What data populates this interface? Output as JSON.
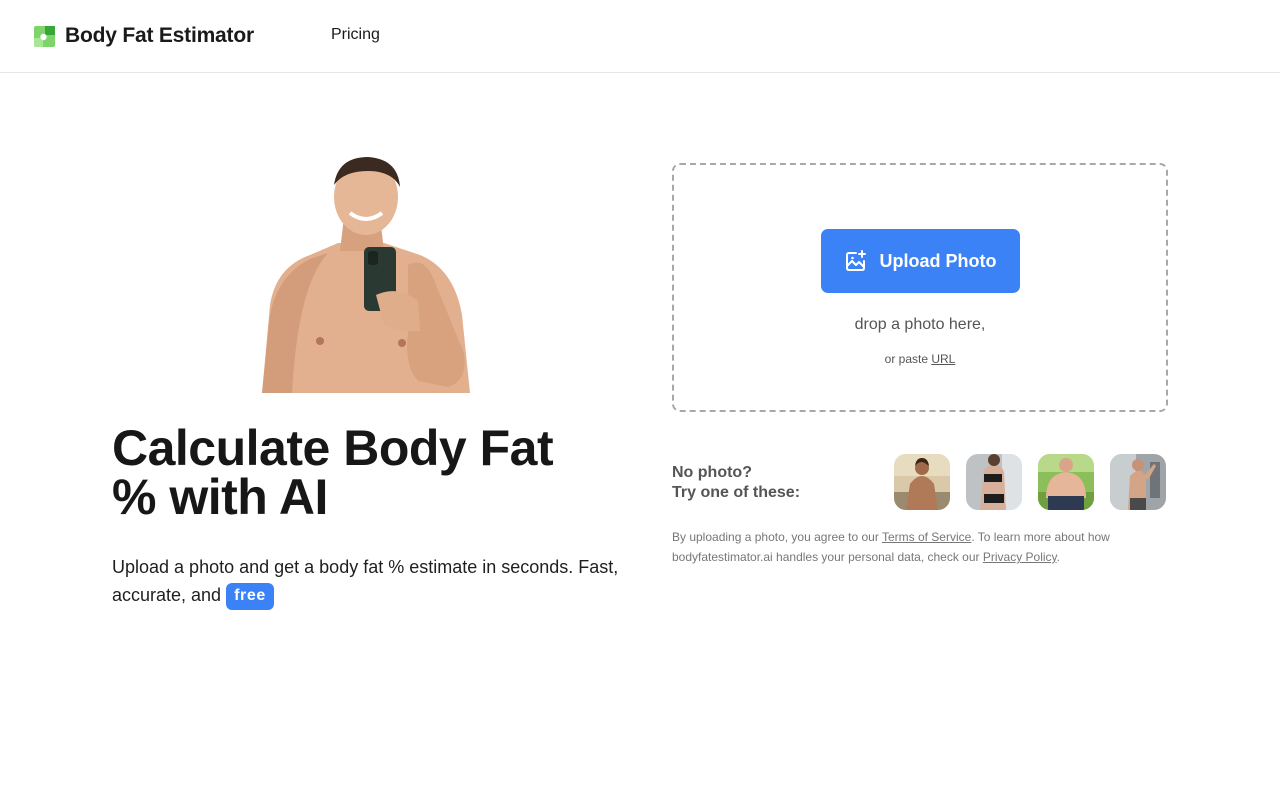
{
  "header": {
    "brand": "Body Fat Estimator",
    "nav": {
      "pricing": "Pricing"
    }
  },
  "hero": {
    "headline_line1": "Calculate Body Fat",
    "headline_line2": "% with AI",
    "subtext": "Upload a photo and get a body fat % estimate in seconds. Fast, accurate, and",
    "badge": "free"
  },
  "upload": {
    "button_label": "Upload Photo",
    "drop_text": "drop a photo here,",
    "paste_prefix": "or paste",
    "paste_link": "URL"
  },
  "samples": {
    "line1": "No photo?",
    "line2": "Try one of these:"
  },
  "legal": {
    "prefix": "By uploading a photo, you agree to our",
    "terms": "Terms of Service",
    "middle": ". To learn more about how bodyfatestimator.ai handles your personal data, check our",
    "privacy": "Privacy Policy",
    "suffix": "."
  },
  "colors": {
    "accent": "#3b82f6",
    "logo_green": "#5cc45c",
    "border": "#a8a8a8"
  },
  "icons": {
    "logo": "app-logo-icon",
    "upload": "image-upload-icon"
  }
}
